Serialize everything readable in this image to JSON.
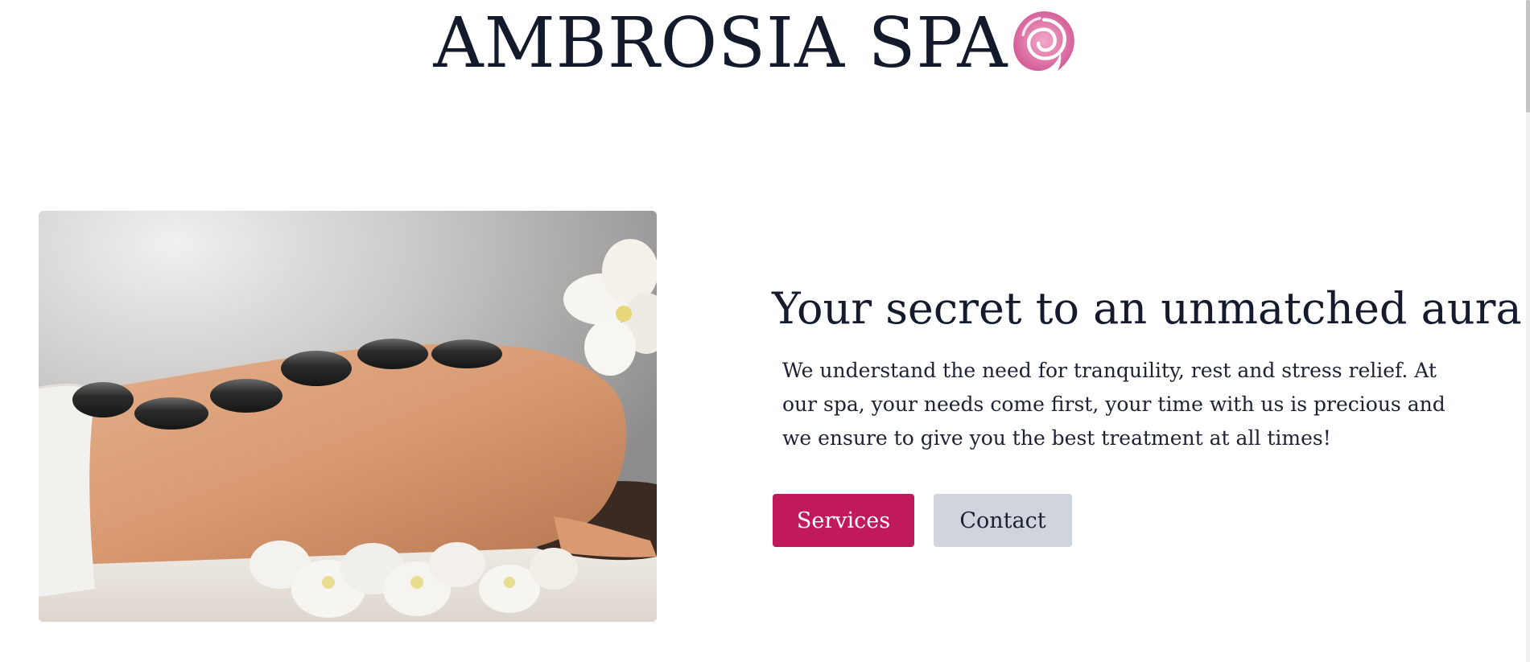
{
  "brand": {
    "name": "AMBROSIA SPA",
    "logo_icon": "rose-swirl-icon",
    "logo_color": "#e07aa6"
  },
  "hero": {
    "image_alt": "hot stone massage with white orchids",
    "title": "Your secret to an unmatched aura",
    "description": "We understand the need for tranquility, rest and stress relief. At our spa, your needs come first, your time with us is precious and we ensure to give you the best treatment at all times!",
    "buttons": {
      "services_label": "Services",
      "contact_label": "Contact"
    }
  },
  "colors": {
    "primary": "#c01a5d",
    "secondary": "#d0d4dc",
    "text": "#131a2b"
  }
}
